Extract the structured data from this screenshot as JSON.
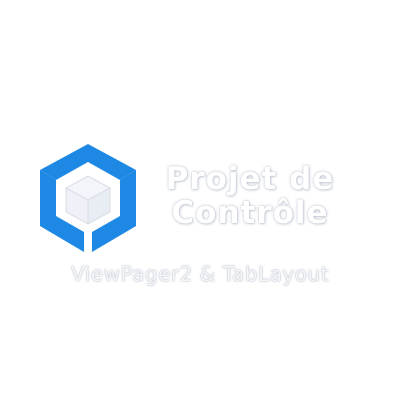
{
  "splash": {
    "title_line1": "Projet de",
    "title_line2": "Contrôle",
    "subtitle": "ViewPager2 & TabLayout",
    "logo_icon": "hexagon-cube-icon",
    "accent_color": "#1e88e5"
  }
}
